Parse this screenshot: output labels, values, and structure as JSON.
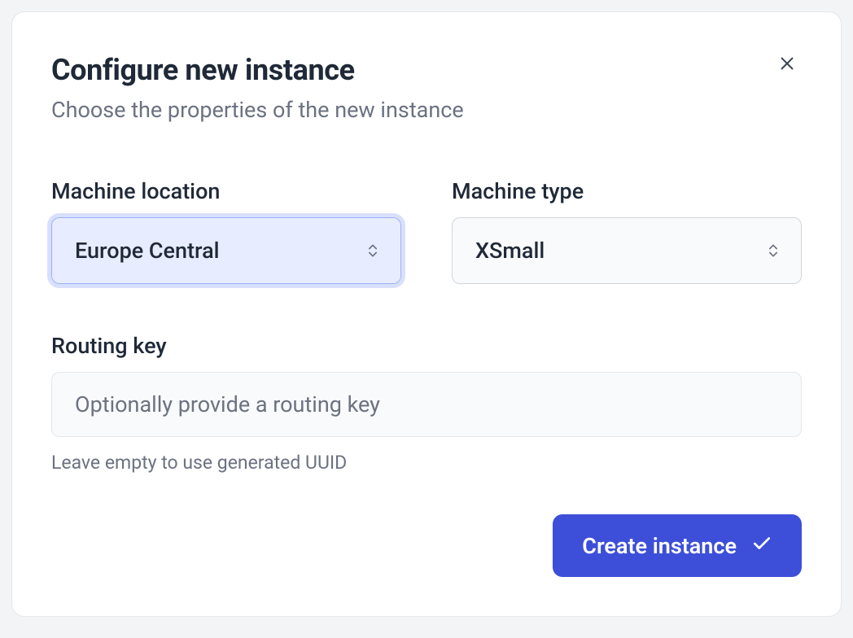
{
  "dialog": {
    "title": "Configure new instance",
    "subtitle": "Choose the properties of the new instance"
  },
  "fields": {
    "location": {
      "label": "Machine location",
      "value": "Europe Central"
    },
    "machine_type": {
      "label": "Machine type",
      "value": "XSmall"
    },
    "routing_key": {
      "label": "Routing key",
      "placeholder": "Optionally provide a routing key",
      "helper": "Leave empty to use generated UUID",
      "value": ""
    }
  },
  "actions": {
    "create_label": "Create instance"
  }
}
